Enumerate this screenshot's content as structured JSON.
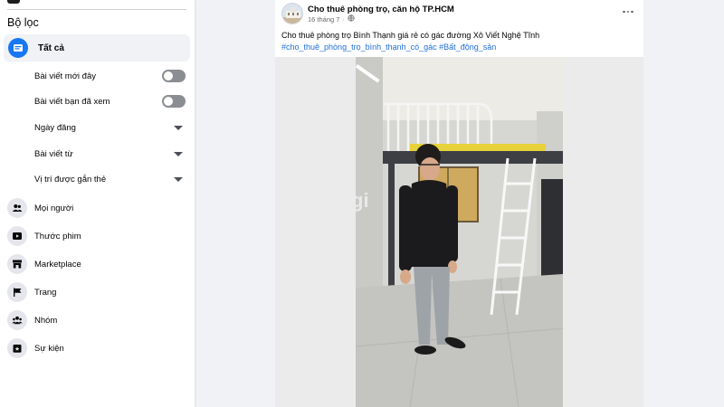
{
  "sidebar": {
    "filter_title": "Bộ lọc",
    "all_label": "Tất cả",
    "filters": [
      {
        "label": "Bài viết mới đây",
        "control": "toggle",
        "on": false
      },
      {
        "label": "Bài viết bạn đã xem",
        "control": "toggle",
        "on": false
      },
      {
        "label": "Ngày đăng",
        "control": "dropdown"
      },
      {
        "label": "Bài viết từ",
        "control": "dropdown"
      },
      {
        "label": "Vị trí được gắn thẻ",
        "control": "dropdown"
      }
    ],
    "nav": [
      {
        "label": "Mọi người",
        "icon": "people-icon"
      },
      {
        "label": "Thước phim",
        "icon": "reels-icon"
      },
      {
        "label": "Marketplace",
        "icon": "marketplace-icon"
      },
      {
        "label": "Trang",
        "icon": "flag-icon"
      },
      {
        "label": "Nhóm",
        "icon": "groups-icon"
      },
      {
        "label": "Sự kiện",
        "icon": "calendar-star-icon"
      }
    ]
  },
  "post": {
    "page_name": "Cho thuê phòng trọ, căn hộ TP.HCM",
    "date": "16 tháng 7",
    "separator": "·",
    "audience_icon": "globe-icon",
    "text": "Cho thuê phòng trọ Bình Thạnh giá rẻ có gác đường Xô Viết Nghệ Tĩnh",
    "hashtags": [
      "#cho_thuê_phòng_trọ_bình_thạnh_có_gác",
      "#Bất_động_sản"
    ],
    "photo_watermark": "mogi"
  },
  "colors": {
    "accent": "#1877f2",
    "link": "#216fdb",
    "page_bg": "#f0f2f5",
    "toggle_off": "#8a8d91"
  }
}
